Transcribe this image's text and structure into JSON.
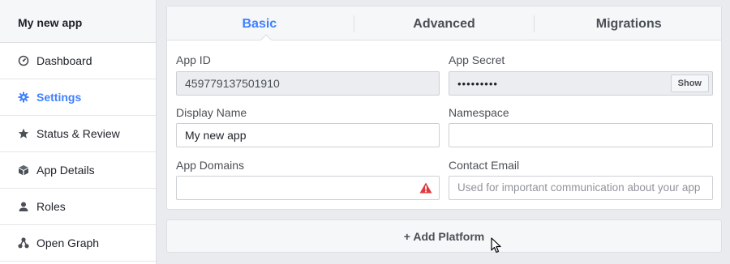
{
  "sidebar": {
    "app_name": "My new app",
    "items": [
      {
        "label": "Dashboard",
        "icon": "dashboard-icon",
        "active": false
      },
      {
        "label": "Settings",
        "icon": "gear-icon",
        "active": true
      },
      {
        "label": "Status & Review",
        "icon": "star-icon",
        "active": false
      },
      {
        "label": "App Details",
        "icon": "cube-icon",
        "active": false
      },
      {
        "label": "Roles",
        "icon": "person-icon",
        "active": false
      },
      {
        "label": "Open Graph",
        "icon": "graph-icon",
        "active": false
      }
    ]
  },
  "tabs": [
    "Basic",
    "Advanced",
    "Migrations"
  ],
  "active_tab": "Basic",
  "form": {
    "app_id": {
      "label": "App ID",
      "value": "459779137501910"
    },
    "app_secret": {
      "label": "App Secret",
      "value": "•••••••••",
      "show_label": "Show"
    },
    "display_name": {
      "label": "Display Name",
      "value": "My new app"
    },
    "namespace": {
      "label": "Namespace",
      "value": ""
    },
    "app_domains": {
      "label": "App Domains",
      "value": ""
    },
    "contact_email": {
      "label": "Contact Email",
      "value": "",
      "placeholder": "Used for important communication about your app"
    }
  },
  "add_platform_label": "+ Add Platform",
  "colors": {
    "accent": "#4080ff",
    "warning": "#e0393e",
    "background": "#e9ebee"
  }
}
